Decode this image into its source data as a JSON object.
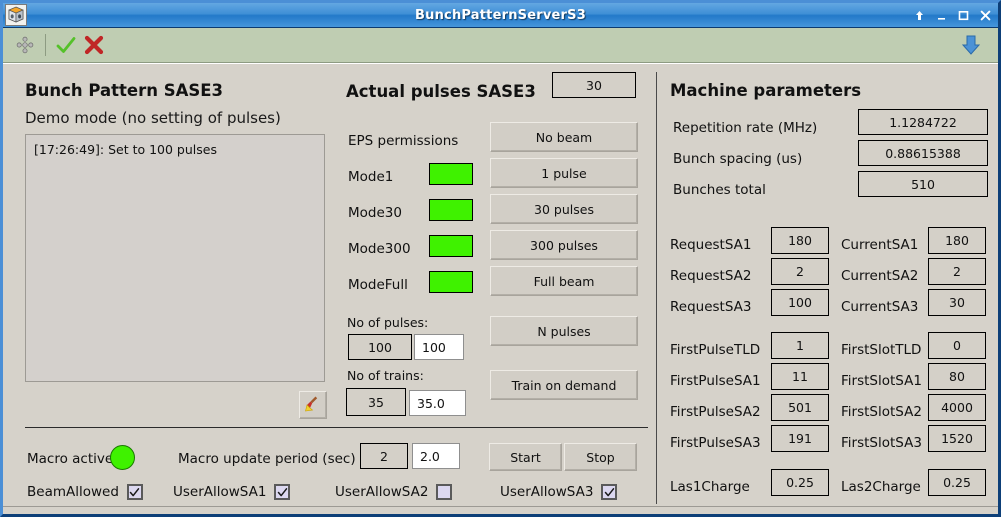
{
  "window": {
    "title": "BunchPatternServerS3",
    "icon": "cube-icon",
    "controls": [
      {
        "name": "always-on-top-button",
        "glyph": "up-arrow-icon"
      },
      {
        "name": "minimize-button",
        "glyph": "minimize-icon"
      },
      {
        "name": "maximize-button",
        "glyph": "maximize-icon"
      },
      {
        "name": "close-button",
        "glyph": "close-icon"
      }
    ]
  },
  "toolbar": {
    "items": [
      {
        "name": "move-handle-icon",
        "label": ""
      },
      {
        "name": "apply-check-icon",
        "label": ""
      },
      {
        "name": "cancel-cross-icon",
        "label": ""
      }
    ],
    "right_item": {
      "name": "collapse-down-arrow-icon",
      "label": ""
    }
  },
  "left_panel": {
    "title": "Bunch Pattern SASE3",
    "subtitle": "Demo mode (no setting of pulses)",
    "log_lines": [
      "[17:26:49]: Set to 100 pulses"
    ],
    "clear_button": {
      "name": "clear-log-button",
      "icon": "broom-icon"
    }
  },
  "center_panel": {
    "title": "Actual pulses SASE3",
    "actual_pulses_value": "30",
    "eps_label": "EPS permissions",
    "modes": [
      {
        "label": "Mode1",
        "state_color": "#3ff200"
      },
      {
        "label": "Mode30",
        "state_color": "#3ff200"
      },
      {
        "label": "Mode300",
        "state_color": "#3ff200"
      },
      {
        "label": "ModeFull",
        "state_color": "#3ff200"
      }
    ],
    "buttons": [
      {
        "label": "No beam"
      },
      {
        "label": "1 pulse"
      },
      {
        "label": "30 pulses"
      },
      {
        "label": "300 pulses"
      },
      {
        "label": "Full beam"
      },
      {
        "label": "N pulses"
      },
      {
        "label": "Train on demand"
      }
    ],
    "no_of_pulses": {
      "label": "No of pulses:",
      "readback": "100",
      "input_value": "100"
    },
    "no_of_trains": {
      "label": "No of trains:",
      "readback": "35",
      "input_value": "35.0"
    }
  },
  "right_panel": {
    "title": "Machine parameters",
    "params": [
      {
        "label": "Repetition rate (MHz)",
        "value": "1.1284722"
      },
      {
        "label": "Bunch spacing (us)",
        "value": "0.88615388"
      },
      {
        "label": "Bunches total",
        "value": "510"
      }
    ],
    "request_current": [
      {
        "left_label": "RequestSA1",
        "left_value": "180",
        "right_label": "CurrentSA1",
        "right_value": "180"
      },
      {
        "left_label": "RequestSA2",
        "left_value": "2",
        "right_label": "CurrentSA2",
        "right_value": "2"
      },
      {
        "left_label": "RequestSA3",
        "left_value": "100",
        "right_label": "CurrentSA3",
        "right_value": "30"
      }
    ],
    "pulse_slot": [
      {
        "left_label": "FirstPulseTLD",
        "left_value": "1",
        "right_label": "FirstSlotTLD",
        "right_value": "0"
      },
      {
        "left_label": "FirstPulseSA1",
        "left_value": "11",
        "right_label": "FirstSlotSA1",
        "right_value": "80"
      },
      {
        "left_label": "FirstPulseSA2",
        "left_value": "501",
        "right_label": "FirstSlotSA2",
        "right_value": "4000"
      },
      {
        "left_label": "FirstPulseSA3",
        "left_value": "191",
        "right_label": "FirstSlotSA3",
        "right_value": "1520"
      }
    ],
    "charges": [
      {
        "left_label": "Las1Charge",
        "left_value": "0.25",
        "right_label": "Las2Charge",
        "right_value": "0.25"
      }
    ]
  },
  "bottom_panel": {
    "macro_active_label": "Macro active",
    "macro_active_color": "#3ff200",
    "macro_period_label": "Macro update period (sec)",
    "macro_period_readback": "2",
    "macro_period_input": "2.0",
    "start_button": "Start",
    "stop_button": "Stop",
    "checkboxes": [
      {
        "label": "BeamAllowed",
        "checked": true
      },
      {
        "label": "UserAllowSA1",
        "checked": true
      },
      {
        "label": "UserAllowSA2",
        "checked": false
      },
      {
        "label": "UserAllowSA3",
        "checked": true
      }
    ]
  }
}
